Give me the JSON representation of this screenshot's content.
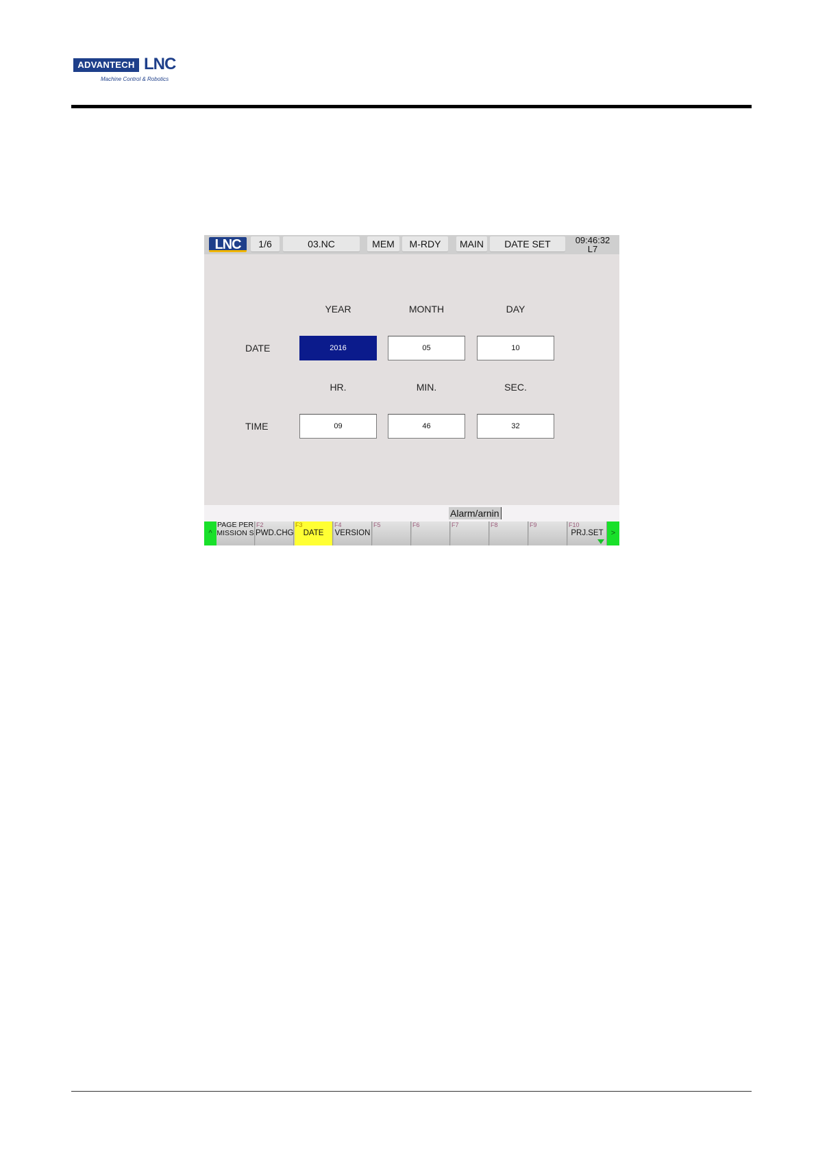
{
  "document_header": {
    "logo_brand": "ADVANTECH",
    "logo_product": "LNC",
    "logo_tagline": "Machine Control & Robotics"
  },
  "screen": {
    "status_bar": {
      "logo": "LNC",
      "page": "1/6",
      "program": "03.NC",
      "mode": "MEM",
      "state": "M-RDY",
      "group": "MAIN",
      "screen_name": "DATE SET",
      "clock": "09:46:32",
      "level": "L7"
    },
    "date_row": {
      "label": "DATE",
      "headers": [
        "YEAR",
        "MONTH",
        "DAY"
      ],
      "values": [
        "2016",
        "05",
        "10"
      ]
    },
    "time_row": {
      "label": "TIME",
      "headers": [
        "HR.",
        "MIN.",
        "SEC."
      ],
      "values": [
        "09",
        "46",
        "32"
      ]
    },
    "alarm_text": "Alarm/arnin",
    "fkeys": [
      {
        "num": "",
        "label": "PAGE PER MISSION S"
      },
      {
        "num": "F2",
        "label": "PWD.CHG"
      },
      {
        "num": "F3",
        "label": "DATE"
      },
      {
        "num": "F4",
        "label": "VERSION"
      },
      {
        "num": "F5",
        "label": ""
      },
      {
        "num": "F6",
        "label": ""
      },
      {
        "num": "F7",
        "label": ""
      },
      {
        "num": "F8",
        "label": ""
      },
      {
        "num": "F9",
        "label": ""
      },
      {
        "num": "F10",
        "label": "PRJ.SET"
      }
    ],
    "nav_left": "^",
    "nav_right": ">",
    "colors": {
      "active_field": "#0b1b8c",
      "selected_fkey": "#ffff33",
      "nav_button": "#19e02a",
      "screen_bg": "#e3dfdf"
    }
  }
}
